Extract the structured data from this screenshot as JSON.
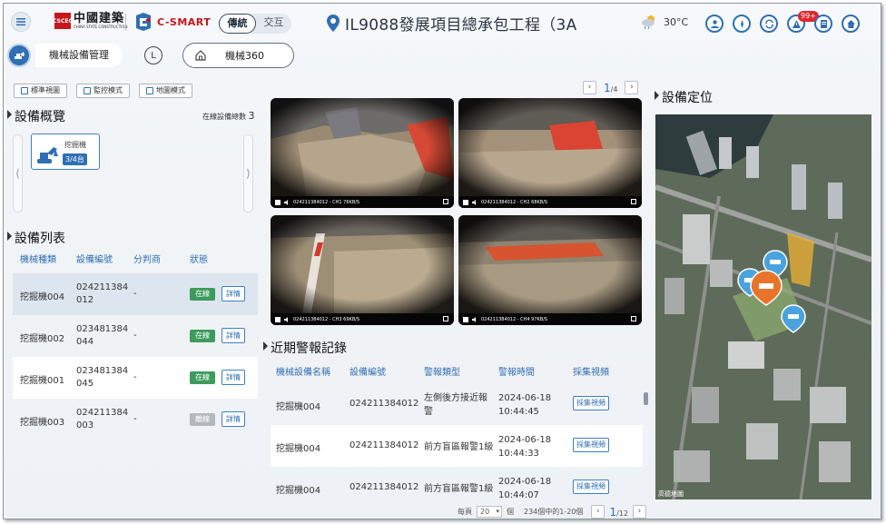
{
  "header": {
    "logo_cn": "中國建築",
    "logo_en": "CHINA STATE CONSTRUCTION",
    "logo_mark": "CSCEC",
    "product": "C-SMART",
    "mode_toggle": [
      "傳統",
      "交互"
    ],
    "mode_selected": "傳統",
    "project_title": "IL9088發展項目總承包工程（3A",
    "temperature": "30°C",
    "alerts_badge": "99+",
    "icons": [
      "user-icon",
      "compass-icon",
      "refresh-icon",
      "alert-icon",
      "document-icon",
      "home-icon"
    ]
  },
  "subnav": {
    "module": "機械設備管理",
    "clock_label": "L",
    "tab": "機械360"
  },
  "view_buttons": [
    "標準視圖",
    "監控模式",
    "地圖模式"
  ],
  "overview": {
    "title": "設備概覽",
    "online_label": "在線設備總數",
    "online_value": "3",
    "card_name": "挖掘機",
    "card_count": "3/4台",
    "left_arrow": "⟨",
    "right_arrow": "⟩"
  },
  "equipment_list": {
    "title": "設備列表",
    "columns": [
      "機械種類",
      "設備編號",
      "分判商",
      "狀態"
    ],
    "rows": [
      {
        "type": "挖掘機004",
        "id_line1": "024211384",
        "id_line2": "012",
        "sub": "-",
        "status": "在線",
        "status_color": "#3d9b5d",
        "action": "詳情"
      },
      {
        "type": "挖掘機002",
        "id_line1": "023481384",
        "id_line2": "044",
        "sub": "-",
        "status": "在線",
        "status_color": "#3d9b5d",
        "action": "詳情"
      },
      {
        "type": "挖掘機001",
        "id_line1": "023481384",
        "id_line2": "045",
        "sub": "-",
        "status": "在線",
        "status_color": "#3d9b5d",
        "action": "詳情"
      },
      {
        "type": "挖掘機003",
        "id_line1": "024211384",
        "id_line2": "003",
        "sub": "-",
        "status": "離線",
        "status_color": "#b4b8bd",
        "action": "詳情"
      }
    ]
  },
  "cameras": {
    "page_current": "1",
    "page_total": "/4",
    "feeds": [
      {
        "caption": "024211384012 - CH1 76KB/S"
      },
      {
        "caption": "024211384012 - CH2 68KB/S"
      },
      {
        "caption": "024211384012 - CH3 69KB/S"
      },
      {
        "caption": "024211384012 - CH4 97KB/S"
      }
    ]
  },
  "alarms": {
    "title": "近期警報記錄",
    "columns": [
      "機械設備名稱",
      "設備編號",
      "警報類型",
      "警報時間",
      "採集視頻"
    ],
    "rows": [
      {
        "name": "挖掘機004",
        "id": "024211384012",
        "type_line1": "左側後方接近報",
        "type_line2": "警",
        "date": "2024-06-18",
        "time": "10:44:45",
        "action": "採集視頻"
      },
      {
        "name": "挖掘機004",
        "id": "024211384012",
        "type_line1": "前方盲區報警1級",
        "type_line2": "",
        "date": "2024-06-18",
        "time": "10:44:33",
        "action": "採集視頻"
      },
      {
        "name": "挖掘機004",
        "id": "024211384012",
        "type_line1": "前方盲區報警1級",
        "type_line2": "",
        "date": "2024-06-18",
        "time": "10:44:07",
        "action": "採集視頻"
      }
    ],
    "pager": {
      "per_page_label": "每頁",
      "per_page": "20",
      "unit": "個",
      "summary": "234個中的1-20個",
      "current": "1",
      "total": "/12"
    }
  },
  "location": {
    "title": "設備定位",
    "credit": "高德地圖"
  },
  "colors": {
    "accent": "#2f6fb3",
    "online": "#3d9b5d",
    "offline": "#b4b8bd",
    "marker_active": "#e8742c",
    "marker": "#4aa3df"
  }
}
